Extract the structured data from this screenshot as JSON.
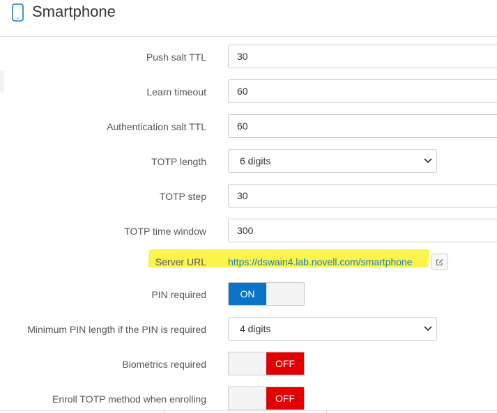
{
  "header": {
    "title": "Smartphone",
    "icon": "smartphone-icon"
  },
  "fields": {
    "push_salt_ttl": {
      "label": "Push salt TTL",
      "value": "30"
    },
    "learn_timeout": {
      "label": "Learn timeout",
      "value": "60"
    },
    "auth_salt_ttl": {
      "label": "Authentication salt TTL",
      "value": "60"
    },
    "totp_length": {
      "label": "TOTP length",
      "value": "6 digits"
    },
    "totp_step": {
      "label": "TOTP step",
      "value": "30"
    },
    "totp_time_window": {
      "label": "TOTP time window",
      "value": "300"
    },
    "server_url": {
      "label": "Server URL",
      "value": "https://dswain4.lab.novell.com/smartphone"
    },
    "pin_required": {
      "label": "PIN required",
      "state": "ON"
    },
    "min_pin_length": {
      "label": "Minimum PIN length if the PIN is required",
      "value": "4 digits"
    },
    "biometrics_required": {
      "label": "Biometrics required",
      "state": "OFF"
    },
    "enroll_totp": {
      "label": "Enroll TOTP method when enrolling",
      "state": "OFF"
    }
  },
  "colors": {
    "toggle_on": "#0b74c9",
    "toggle_off": "#e30000",
    "link": "#1a7fb5",
    "highlight": "#f9f33a"
  }
}
